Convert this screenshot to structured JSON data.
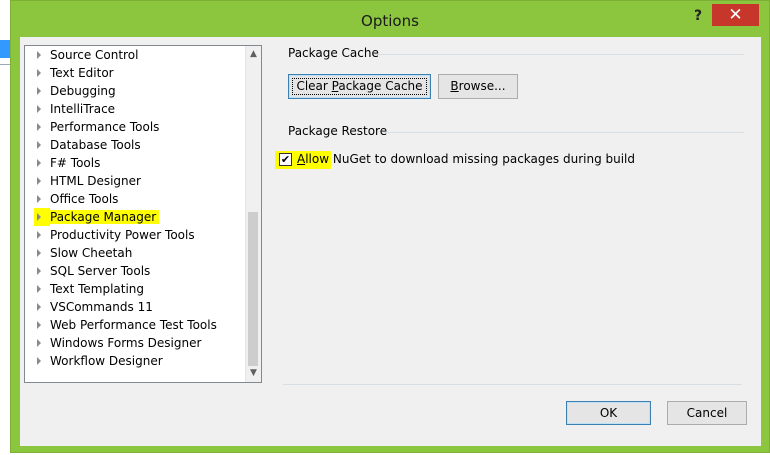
{
  "window": {
    "title": "Options",
    "help_glyph": "?",
    "close_glyph": "✕"
  },
  "tree": {
    "items": [
      {
        "label": "Source Control"
      },
      {
        "label": "Text Editor"
      },
      {
        "label": "Debugging"
      },
      {
        "label": "IntelliTrace"
      },
      {
        "label": "Performance Tools"
      },
      {
        "label": "Database Tools"
      },
      {
        "label": "F# Tools"
      },
      {
        "label": "HTML Designer"
      },
      {
        "label": "Office Tools"
      },
      {
        "label": "Package Manager",
        "selected": true
      },
      {
        "label": "Productivity Power Tools"
      },
      {
        "label": "Slow Cheetah"
      },
      {
        "label": "SQL Server Tools"
      },
      {
        "label": "Text Templating"
      },
      {
        "label": "VSCommands 11"
      },
      {
        "label": "Web Performance Test Tools"
      },
      {
        "label": "Windows Forms Designer"
      },
      {
        "label": "Workflow Designer"
      }
    ],
    "scroll_up_glyph": "▲",
    "scroll_down_glyph": "▼"
  },
  "package_cache": {
    "heading": "Package Cache",
    "clear_button_pre": "Clear ",
    "clear_button_accel": "P",
    "clear_button_post": "ackage Cache",
    "browse_button_accel": "B",
    "browse_button_post": "rowse..."
  },
  "package_restore": {
    "heading": "Package Restore",
    "checkbox_checked": true,
    "check_glyph": "✔",
    "checkbox_label_accel": "A",
    "checkbox_label_post": "llow NuGet to download missing packages during build"
  },
  "footer": {
    "ok_label": "OK",
    "cancel_label": "Cancel"
  },
  "colors": {
    "window_frame": "#8cc63f",
    "close_button": "#c7362a",
    "highlight": "#ffff00"
  }
}
